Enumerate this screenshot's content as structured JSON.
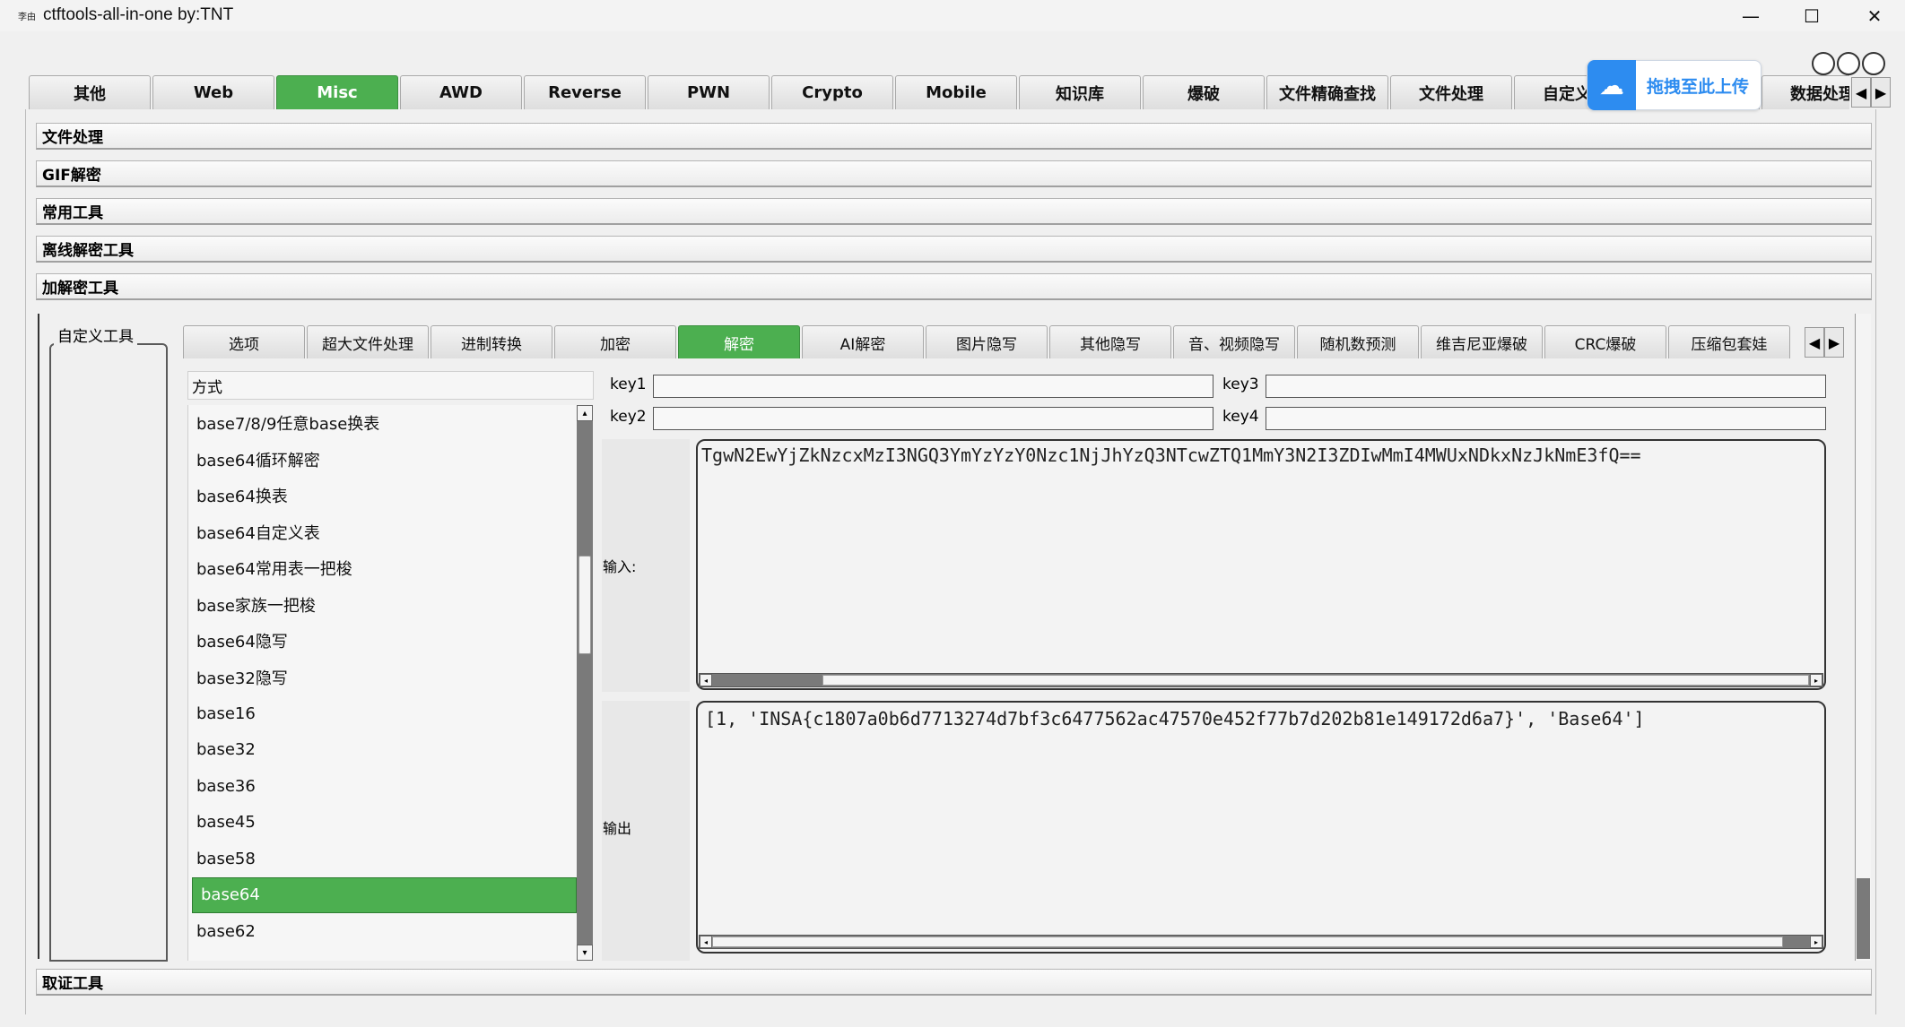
{
  "window": {
    "app_icon_text": "李由",
    "title": "ctftools-all-in-one   by:TNT",
    "controls": {
      "minimize": "—",
      "maximize": "☐",
      "close": "✕"
    }
  },
  "main_tabs": [
    "其他",
    "Web",
    "Misc",
    "AWD",
    "Reverse",
    "PWN",
    "Crypto",
    "Mobile",
    "知识库",
    "爆破",
    "文件精确查找",
    "文件处理",
    "自定义大",
    "",
    "数据处理"
  ],
  "main_tab_active": "Misc",
  "upload_popup": {
    "icon": "cloud-icon",
    "text": "拖拽至此上传"
  },
  "sections": {
    "file_processing": "文件处理",
    "gif_decrypt": "GIF解密",
    "common_tools": "常用工具",
    "offline_decrypt": "离线解密工具",
    "encrypt_decrypt": "加解密工具",
    "forensics": "取证工具"
  },
  "side_group_label": "自定义工具",
  "sub_tabs": [
    "选项",
    "超大文件处理",
    "进制转换",
    "加密",
    "解密",
    "AI解密",
    "图片隐写",
    "其他隐写",
    "音、视频隐写",
    "随机数预测",
    "维吉尼亚爆破",
    "CRC爆破",
    "压缩包套娃"
  ],
  "sub_tab_active": "解密",
  "method_header": "方式",
  "methods": [
    "base7/8/9任意base换表",
    "base64循环解密",
    "base64换表",
    "base64自定义表",
    "base64常用表一把梭",
    "base家族一把梭",
    "base64隐写",
    "base32隐写",
    "base16",
    "base32",
    "base36",
    "base45",
    "base58",
    "base64",
    "base62"
  ],
  "method_active": "base64",
  "keys": {
    "key1": "key1",
    "key2": "key2",
    "key3": "key3",
    "key4": "key4"
  },
  "io": {
    "input_label": "输入:",
    "output_label": "输出",
    "input_value": "TgwN2EwYjZkNzcxMzI3NGQ3YmYzYzY0Nzc1NjJhYzQ3NTcwZTQ1MmY3N2I3ZDIwMmI4MWUxNDkxNzJkNmE3fQ==",
    "output_value": "[1, 'INSA{c1807a0b6d7713274d7bf3c6477562ac47570e452f77b7d202b81e149172d6a7}', 'Base64']"
  },
  "colors": {
    "accent": "#4caf50",
    "upload_blue": "#2d8cf0"
  }
}
